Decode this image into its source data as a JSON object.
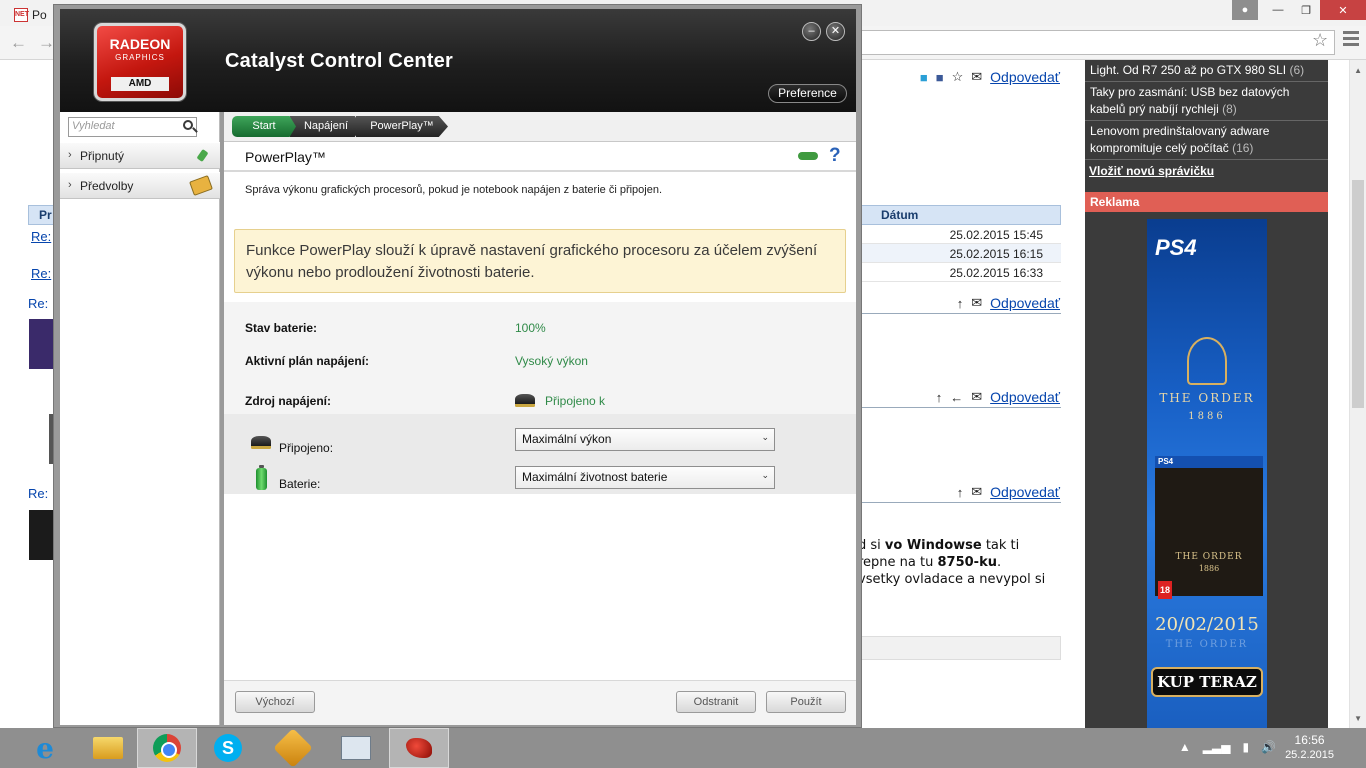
{
  "browser": {
    "tab_favicon_text": "NET",
    "tab_title": "Po",
    "window_buttons": {
      "minimize": "—",
      "restore": "❐",
      "close": "✕"
    }
  },
  "forum": {
    "left_header": "Pr",
    "links": [
      "Re:",
      "Re:"
    ],
    "re_labels": [
      "Re:",
      "Re:"
    ],
    "reply_link": "Odpovedať",
    "date_header": "Dátum",
    "dates": [
      "25.02.2015 15:45",
      "25.02.2015 16:15",
      "25.02.2015 16:33"
    ],
    "post_lines": [
      {
        "pre": "d si ",
        "bold": "vo Windowse",
        "post": " tak ti"
      },
      {
        "pre": "repne na tu ",
        "bold": "8750-ku",
        "post": "."
      },
      {
        "pre": "vsetky ovladace a nevypol si",
        "bold": "",
        "post": ""
      }
    ]
  },
  "sidebar_news": {
    "items": [
      {
        "text": "Light. Od R7 250 až po GTX 980 SLI",
        "count": "(6)"
      },
      {
        "text": "Taky pro zasmání: USB bez datových kabelů prý nabíjí rychleji",
        "count": "(8)"
      },
      {
        "text": "Lenovom predinštalovaný adware kompromituje celý počítač",
        "count": "(16)"
      }
    ],
    "add_link": "Vložiť novú správičku",
    "ad_header": "Reklama"
  },
  "ad": {
    "ps4": "PS4",
    "title": "THE ORDER",
    "year": "1886",
    "box_ps4": "PS4",
    "box_title": "THE ORDER",
    "box_year": "1886",
    "pegi": "18",
    "release_date": "20/02/2015",
    "ghost_title": "THE ORDER",
    "cta": "KUP TERAZ"
  },
  "ccc": {
    "logo": {
      "radeon": "RADEON",
      "graphics": "GRAPHICS",
      "amd": "AMD"
    },
    "title": "Catalyst Control Center",
    "preference_button": "Preference",
    "minimize_symbol": "–",
    "close_symbol": "✕",
    "search_placeholder": "Vyhledat",
    "nav": [
      {
        "label": "Připnutý"
      },
      {
        "label": "Předvolby"
      }
    ],
    "breadcrumb": [
      "Start",
      "Napájení",
      "PowerPlay™"
    ],
    "section_title": "PowerPlay™",
    "help_symbol": "?",
    "description": "Správa výkonu grafických procesorů, pokud je notebook napájen z baterie či připojen.",
    "info_text": "Funkce PowerPlay slouží k úpravě nastavení grafického procesoru za účelem zvýšení výkonu nebo prodloužení životnosti baterie.",
    "stats": [
      {
        "label": "Stav baterie:",
        "value": "100%"
      },
      {
        "label": "Aktivní plán napájení:",
        "value": "Vysoký výkon"
      },
      {
        "label": "Zdroj napájení:",
        "value": "Připojeno k"
      }
    ],
    "power_rows": [
      {
        "label": "Připojeno:",
        "selected": "Maximální výkon"
      },
      {
        "label": "Baterie:",
        "selected": "Maximální životnost baterie"
      }
    ],
    "buttons": {
      "defaults": "Výchozí",
      "discard": "Odstranit",
      "apply": "Použít"
    }
  },
  "taskbar": {
    "ie_symbol": "e",
    "skype_symbol": "S",
    "time": "16:56",
    "date": "25.2.2015"
  }
}
